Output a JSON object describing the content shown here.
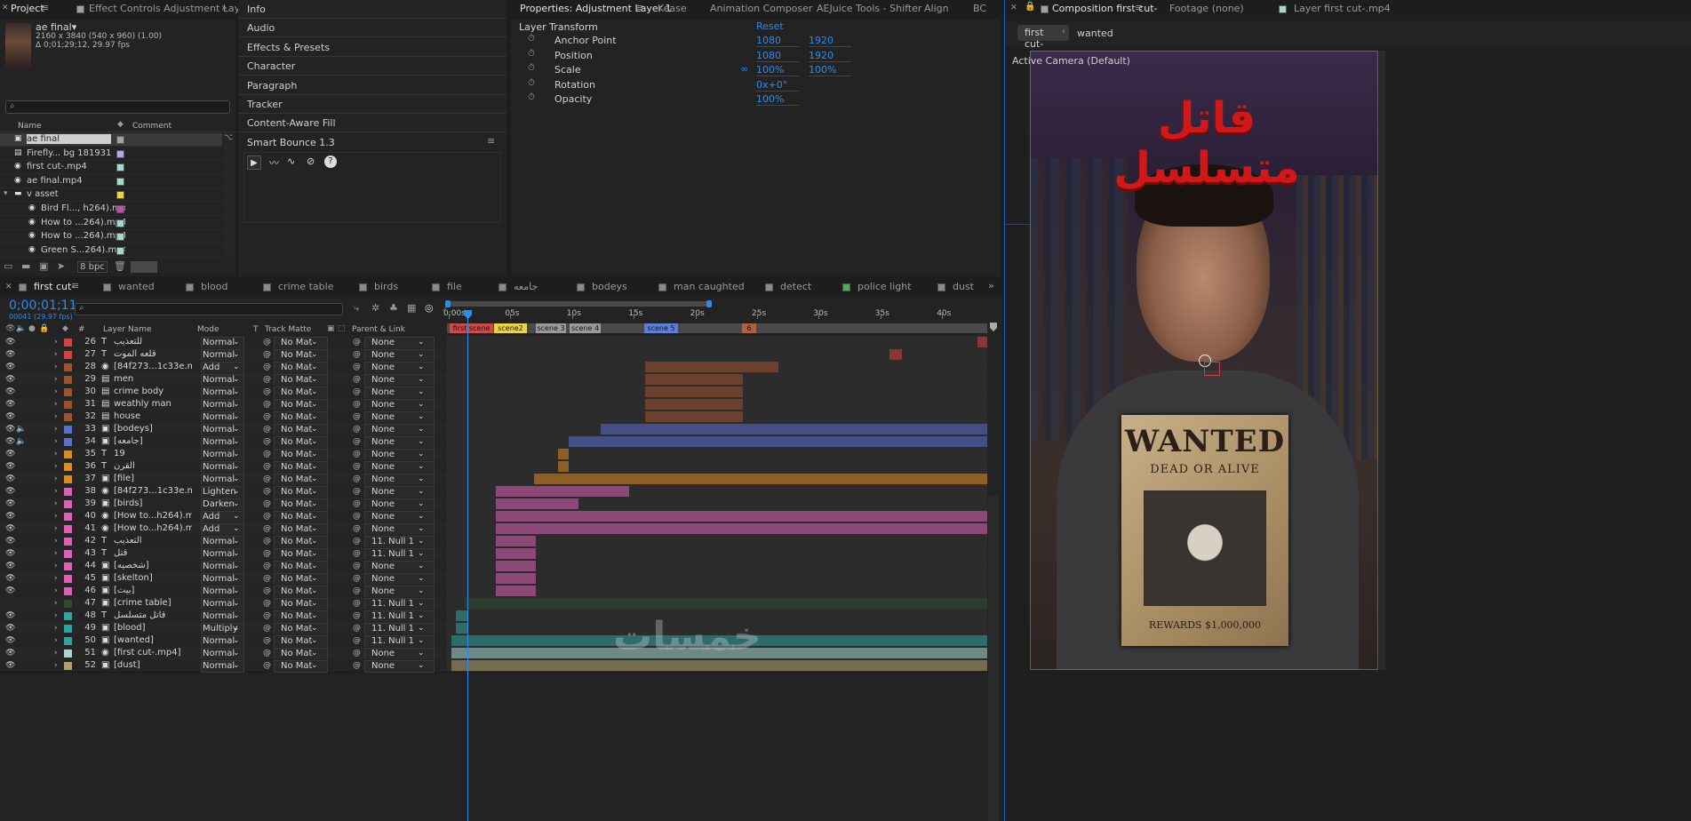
{
  "project_panel": {
    "tabs": [
      "Project",
      "Effect Controls Adjustment Layer 1"
    ],
    "comp_name": "ae final▾",
    "info_line1": "2160 x 3840  (540 x 960) (1.00)",
    "info_line2": "Δ 0;01;29;12, 29.97 fps",
    "search_placeholder": "",
    "col_name": "Name",
    "col_comment": "Comment",
    "items": [
      {
        "name": "ae final",
        "swatch": "#a9a099",
        "icon": "comp-icon",
        "indent": 0
      },
      {
        "name": "Firefly... bg 181931.png",
        "swatch": "#b9a8e0",
        "icon": "image-icon",
        "indent": 0
      },
      {
        "name": "first cut-.mp4",
        "swatch": "#a6d8d2",
        "icon": "footage-icon",
        "indent": 0
      },
      {
        "name": "ae final.mp4",
        "swatch": "#a6d8d2",
        "icon": "footage-icon",
        "indent": 0
      },
      {
        "name": "v asset",
        "swatch": "#e6d35a",
        "icon": "folder-icon",
        "indent": 0
      },
      {
        "name": "Bird Fl..., h264).mp4",
        "swatch": "#b45ba8",
        "icon": "footage-icon",
        "indent": 1
      },
      {
        "name": "How to ...264).mp4",
        "swatch": "#a6d8d2",
        "icon": "footage-icon",
        "indent": 1
      },
      {
        "name": "How to ...264).mp4",
        "swatch": "#a6d8d2",
        "icon": "footage-icon",
        "indent": 1
      },
      {
        "name": "Green S...264).mp4",
        "swatch": "#a6d8d2",
        "icon": "footage-icon",
        "indent": 1
      }
    ],
    "bpc": "8 bpc"
  },
  "middle_panel": {
    "items": [
      "Info",
      "Audio",
      "Effects & Presets",
      "Character",
      "Paragraph",
      "Tracker",
      "Content-Aware Fill"
    ],
    "smart_bounce_title": "Smart Bounce 1.3"
  },
  "properties_panel": {
    "tabs": [
      "Properties: Adjustment Layer 1",
      "Kease",
      "Animation Composer",
      "AEJuice Tools - Shifter",
      "Align",
      "BC"
    ],
    "section_title": "Layer Transform",
    "reset_label": "Reset",
    "props": [
      {
        "name": "Anchor Point",
        "v1": "1080",
        "v2": "1920",
        "link": false
      },
      {
        "name": "Position",
        "v1": "1080",
        "v2": "1920",
        "link": false
      },
      {
        "name": "Scale",
        "v1": "100%",
        "v2": "100%",
        "link": true
      },
      {
        "name": "Rotation",
        "v1": "0x+0°",
        "v2": "",
        "link": false
      },
      {
        "name": "Opacity",
        "v1": "100%",
        "v2": "",
        "link": false
      }
    ]
  },
  "composition_panel": {
    "tabs": [
      "Composition first cut-",
      "Footage (none)",
      "Layer first cut-.mp4"
    ],
    "breadcrumbs": [
      "first cut-",
      "wanted"
    ],
    "camera_label": "Active Camera (Default)",
    "title_text": "قاتل متسلسل",
    "poster_wanted": "WANTED",
    "poster_dead": "DEAD OR ALIVE",
    "poster_reward": "REWARDS $1,000,000"
  },
  "timeline": {
    "comp_tabs": [
      {
        "label": "first cut-",
        "color": "#8a8a8a",
        "active": true
      },
      {
        "label": "wanted",
        "color": "#8a8a8a"
      },
      {
        "label": "blood",
        "color": "#8a8a8a"
      },
      {
        "label": "crime table",
        "color": "#8a8a8a"
      },
      {
        "label": "birds",
        "color": "#8a8a8a"
      },
      {
        "label": "file",
        "color": "#8a8a8a"
      },
      {
        "label": "جامعه",
        "color": "#8a8a8a"
      },
      {
        "label": "bodeys",
        "color": "#8a8a8a"
      },
      {
        "label": "man caughted",
        "color": "#8a8a8a"
      },
      {
        "label": "detect",
        "color": "#8a8a8a"
      },
      {
        "label": "police light",
        "color": "#4caf50"
      },
      {
        "label": "dust",
        "color": "#8a8a8a"
      }
    ],
    "timecode": "0;00;01;11",
    "frame_info": "00041 (29.97 fps)",
    "col_layer_name": "Layer Name",
    "col_mode": "Mode",
    "col_t": "T",
    "col_track_matte": "Track Matte",
    "col_parent": "Parent & Link",
    "ruler_labels": [
      "0:00s",
      "05s",
      "10s",
      "15s",
      "20s",
      "25s",
      "30s",
      "35s",
      "40s"
    ],
    "markers": [
      {
        "label": "first scene",
        "color": "#c94b4b"
      },
      {
        "label": "scene2",
        "color": "#e8d44a"
      },
      {
        "label": "scene 3",
        "color": "#9a9a9a"
      },
      {
        "label": "scene 4",
        "color": "#9a9a9a"
      },
      {
        "label": "scene 5",
        "color": "#5f7fd6"
      },
      {
        "label": "6",
        "color": "#b0603a"
      }
    ],
    "layers": [
      {
        "num": "26",
        "color": "#d94040",
        "type": "T",
        "name": "للتعذيب",
        "mode": "Normal",
        "matte": "No Mat",
        "parent": "None",
        "eye": true
      },
      {
        "num": "27",
        "color": "#d94040",
        "type": "T",
        "name": "قلعه الموت",
        "mode": "Normal",
        "matte": "No Mat",
        "parent": "None",
        "eye": true
      },
      {
        "num": "28",
        "color": "#a0522d",
        "type": "F",
        "name": "[84f273...1c33e.mp4]",
        "mode": "Add",
        "matte": "No Mat",
        "parent": "None",
        "eye": true
      },
      {
        "num": "29",
        "color": "#a0522d",
        "type": "S",
        "name": "men",
        "mode": "Normal",
        "matte": "No Mat",
        "parent": "None",
        "eye": true
      },
      {
        "num": "30",
        "color": "#a0522d",
        "type": "S",
        "name": "crime body",
        "mode": "Normal",
        "matte": "No Mat",
        "parent": "None",
        "eye": true
      },
      {
        "num": "31",
        "color": "#a0522d",
        "type": "S",
        "name": "weathly man",
        "mode": "Normal",
        "matte": "No Mat",
        "parent": "None",
        "eye": true
      },
      {
        "num": "32",
        "color": "#a0522d",
        "type": "S",
        "name": "house",
        "mode": "Normal",
        "matte": "No Mat",
        "parent": "None",
        "eye": true
      },
      {
        "num": "33",
        "color": "#5a6fcf",
        "type": "C",
        "name": "[bodeys]",
        "mode": "Normal",
        "matte": "No Mat",
        "parent": "None",
        "eye": true,
        "audio": true
      },
      {
        "num": "34",
        "color": "#5a6fcf",
        "type": "C",
        "name": "[جامعه]",
        "mode": "Normal",
        "matte": "No Mat",
        "parent": "None",
        "eye": true,
        "audio": true
      },
      {
        "num": "35",
        "color": "#e08a1e",
        "type": "T",
        "name": "19",
        "mode": "Normal",
        "matte": "No Mat",
        "parent": "None",
        "eye": true
      },
      {
        "num": "36",
        "color": "#e08a1e",
        "type": "T",
        "name": "القرن",
        "mode": "Normal",
        "matte": "No Mat",
        "parent": "None",
        "eye": true
      },
      {
        "num": "37",
        "color": "#e08a1e",
        "type": "C",
        "name": "[file]",
        "mode": "Normal",
        "matte": "No Mat",
        "parent": "None",
        "eye": true
      },
      {
        "num": "38",
        "color": "#e060b8",
        "type": "F",
        "name": "[84f273...1c33e.mp4]",
        "mode": "Lighten",
        "matte": "No Mat",
        "parent": "None",
        "eye": true
      },
      {
        "num": "39",
        "color": "#e060b8",
        "type": "C",
        "name": "[birds]",
        "mode": "Darken",
        "matte": "No Mat",
        "parent": "None",
        "eye": true
      },
      {
        "num": "40",
        "color": "#e060b8",
        "type": "F",
        "name": "[How to...h264).mp4]",
        "mode": "Add",
        "matte": "No Mat",
        "parent": "None",
        "eye": true
      },
      {
        "num": "41",
        "color": "#e060b8",
        "type": "F",
        "name": "[How to...h264).mp4]",
        "mode": "Add",
        "matte": "No Mat",
        "parent": "None",
        "eye": true
      },
      {
        "num": "42",
        "color": "#e060b8",
        "type": "T",
        "name": "التعذيب",
        "mode": "Normal",
        "matte": "No Mat",
        "parent": "11. Null 1",
        "eye": true
      },
      {
        "num": "43",
        "color": "#e060b8",
        "type": "T",
        "name": "قتل",
        "mode": "Normal",
        "matte": "No Mat",
        "parent": "11. Null 1",
        "eye": true
      },
      {
        "num": "44",
        "color": "#e060b8",
        "type": "C",
        "name": "[شخصيه]",
        "mode": "Normal",
        "matte": "No Mat",
        "parent": "None",
        "eye": true
      },
      {
        "num": "45",
        "color": "#e060b8",
        "type": "C",
        "name": "[skelton]",
        "mode": "Normal",
        "matte": "No Mat",
        "parent": "None",
        "eye": true
      },
      {
        "num": "46",
        "color": "#e060b8",
        "type": "C",
        "name": "[بيت]",
        "mode": "Normal",
        "matte": "No Mat",
        "parent": "None",
        "eye": true
      },
      {
        "num": "47",
        "color": "#2f4a2f",
        "type": "C",
        "name": "[crime table]",
        "mode": "Normal",
        "matte": "No Mat",
        "parent": "11. Null 1",
        "eye": false
      },
      {
        "num": "48",
        "color": "#2fa3a0",
        "type": "T",
        "name": "قاتل متسلسل",
        "mode": "Normal",
        "matte": "No Mat",
        "parent": "11. Null 1",
        "eye": true
      },
      {
        "num": "49",
        "color": "#2fa3a0",
        "type": "C",
        "name": "[blood]",
        "mode": "Multiply",
        "matte": "No Mat",
        "parent": "11. Null 1",
        "eye": true
      },
      {
        "num": "50",
        "color": "#2fa3a0",
        "type": "C",
        "name": "[wanted]",
        "mode": "Normal",
        "matte": "No Mat",
        "parent": "11. Null 1",
        "eye": true
      },
      {
        "num": "51",
        "color": "#a8d8d0",
        "type": "F",
        "name": "[first cut-.mp4]",
        "mode": "Normal",
        "matte": "No Mat",
        "parent": "None",
        "eye": true
      },
      {
        "num": "52",
        "color": "#b0a070",
        "type": "C",
        "name": "[dust]",
        "mode": "Normal",
        "matte": "No Mat",
        "parent": "None",
        "eye": true
      }
    ],
    "watermark": "خمسات"
  }
}
